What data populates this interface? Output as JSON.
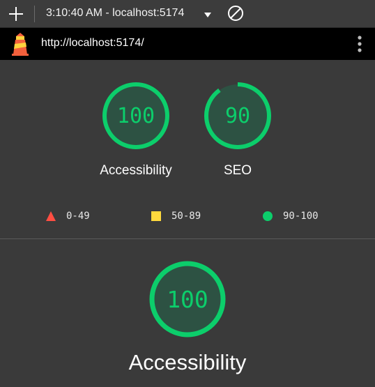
{
  "toolbar": {
    "title": "3:10:40 AM - localhost:5174",
    "icons": [
      "plus-icon",
      "caret-down-icon",
      "block-icon"
    ]
  },
  "urlbar": {
    "url": "http://localhost:5174/",
    "icons": [
      "lighthouse-logo-icon",
      "kebab-menu-icon"
    ]
  },
  "summary": {
    "gauges": [
      {
        "label": "Accessibility",
        "score": "100",
        "fraction": 1.0
      },
      {
        "label": "SEO",
        "score": "90",
        "fraction": 0.9
      }
    ]
  },
  "legend": [
    {
      "range": "0-49",
      "shape": "triangle",
      "color": "#ff4e42"
    },
    {
      "range": "50-89",
      "shape": "square",
      "color": "#ffd93d"
    },
    {
      "range": "90-100",
      "shape": "circle",
      "color": "#0cce6b"
    }
  ],
  "category": {
    "label": "Accessibility",
    "score": "100",
    "fraction": 1.0
  },
  "colors": {
    "pass": "#0cce6b",
    "gauge_bg": "#2d5243",
    "page_bg": "#3a3a3a"
  }
}
